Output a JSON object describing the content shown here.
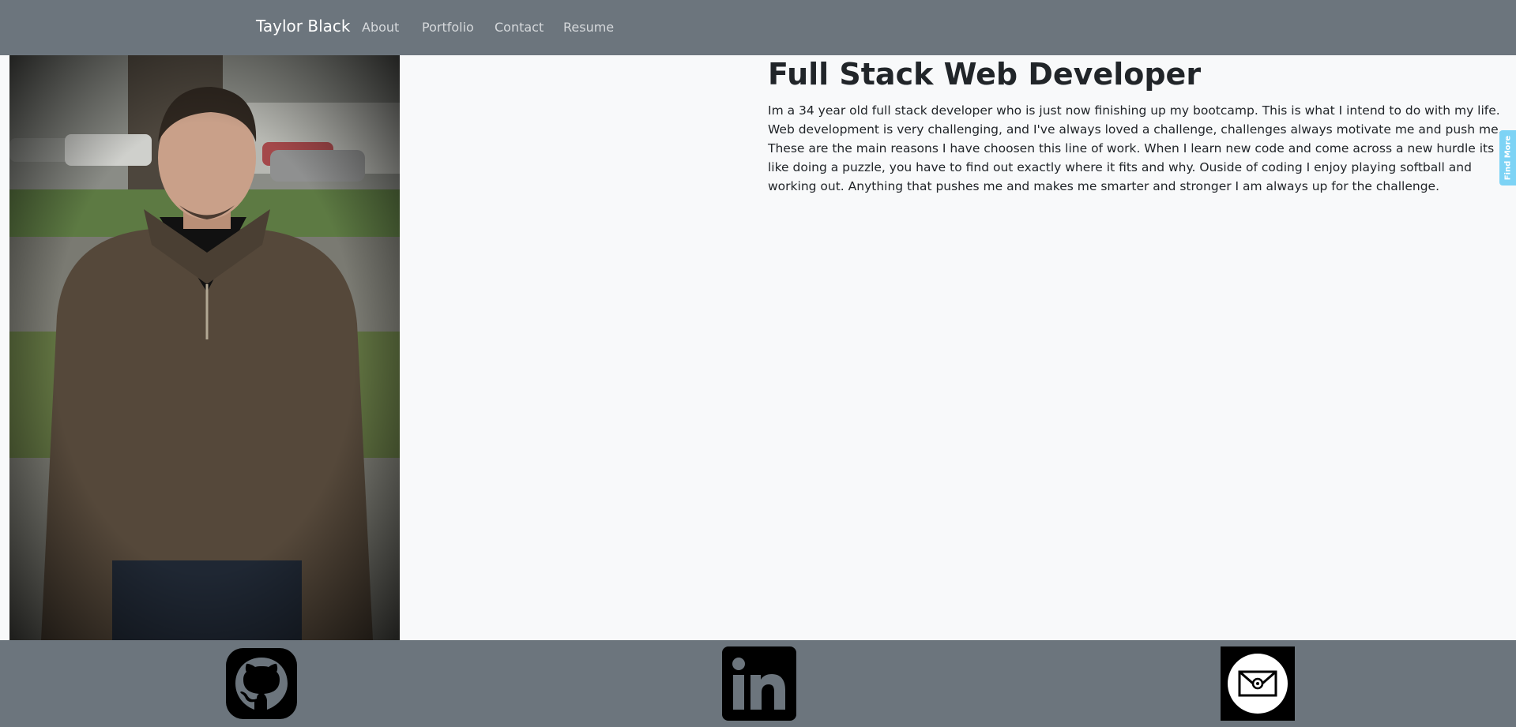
{
  "navbar": {
    "brand": "Taylor Black",
    "links": [
      "About",
      "Portfolio",
      "Contact",
      "Resume"
    ]
  },
  "main": {
    "headline": "Full Stack Web Developer",
    "bio": "Im a 34 year old full stack developer who is just now finishing up my bootcamp. This is what I intend to do with my life. Web development is very challenging, and I've always loved a challenge, challenges always motivate me and push me. These are the main reasons I have choosen this line of work. When I learn new code and come across a new hurdle its like doing a puzzle, you have to find out exactly where it fits and why. Ouside of coding I enjoy playing softball and working out. Anything that pushes me and makes me smarter and stronger I am always up for the challenge."
  },
  "side_tab": {
    "label": "Find More"
  },
  "footer": {
    "icons": [
      "github-icon",
      "linkedin-icon",
      "email-icon"
    ]
  },
  "colors": {
    "navbar_bg": "#6c757d",
    "page_bg": "#f8f9fa",
    "tab_bg": "#7dd3f5",
    "text": "#212529"
  }
}
